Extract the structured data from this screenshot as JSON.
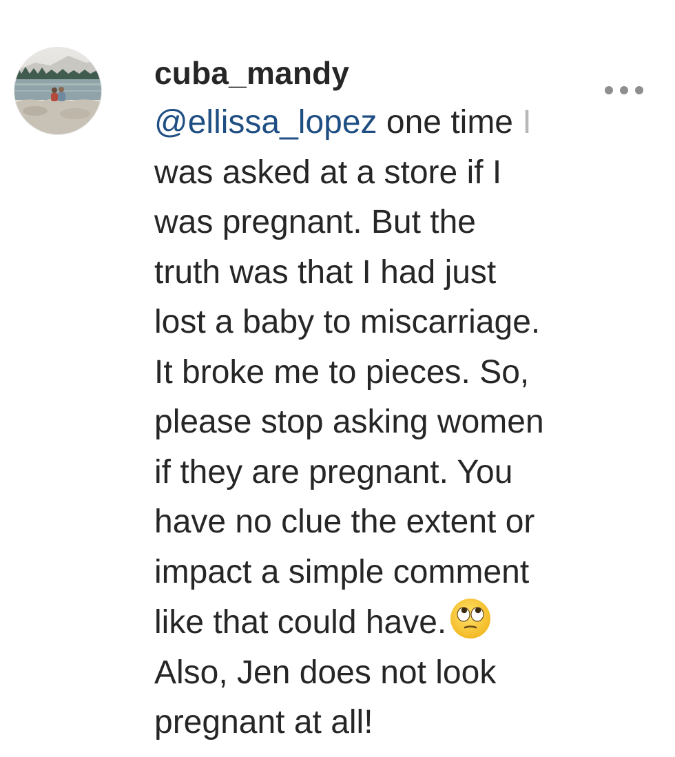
{
  "comment": {
    "username": "cuba_mandy",
    "mention": "@ellissa_lopez",
    "line1_rest": " one time",
    "line1_tail": " I",
    "lines": [
      "was asked at a store if I",
      "was pregnant. But the",
      "truth was that I had just",
      "lost a baby to miscarriage.",
      "It broke me to pieces. So,",
      "please stop asking women",
      "if they are pregnant. You",
      "have no clue the extent or",
      "impact a simple comment"
    ],
    "line_before_emoji": "like that could have.",
    "emoji": "face-with-rolling-eyes",
    "lines_after": [
      "Also, Jen does not look",
      "pregnant at all!"
    ]
  },
  "icons": {
    "more": "more-options-icon"
  },
  "colors": {
    "text": "#262626",
    "mention": "#1f4e82",
    "icon_gray": "#8e8e8e"
  }
}
